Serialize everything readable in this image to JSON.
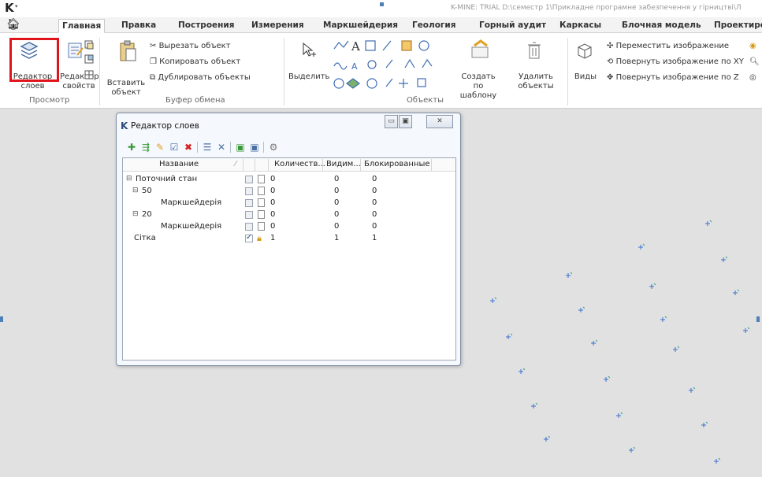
{
  "titlebar": {
    "logo": "K",
    "quick_access": "▾",
    "title": "K-MINE: TRIAL D:\\семестр 1\\Прикладне програмне забезпечення у гірництві\\Л"
  },
  "tabs": [
    {
      "label": "Главная",
      "active": true
    },
    {
      "label": "Правка"
    },
    {
      "label": "Построения"
    },
    {
      "label": "Измерения"
    },
    {
      "label": "Маркшейдерия"
    },
    {
      "label": "Геология"
    },
    {
      "label": "Горный аудит"
    },
    {
      "label": "Каркасы"
    },
    {
      "label": "Блочная модель"
    },
    {
      "label": "Проектиро"
    }
  ],
  "ribbon": {
    "layer_editor": "Редактор\nслоев",
    "props_editor": "Редактор\nсвойств",
    "view_group": "Просмотр",
    "paste": "Вставить\nобъект",
    "cut": "Вырезать объект",
    "copy": "Копировать объект",
    "duplicate": "Дублировать объекты",
    "clipboard_group": "Буфер обмена",
    "select": "Выделить",
    "create_template": "Создать по\nшаблону",
    "delete_objects": "Удалить\nобъекты",
    "objects_group": "Объекты",
    "views": "Виды",
    "move_image": "Переместить изображение",
    "rotate_xy": "Повернуть изображение по XY",
    "rotate_z": "Повернуть изображение по Z"
  },
  "dialog": {
    "title": "Редактор слоев",
    "columns": [
      "Название",
      "Количеств...",
      "Видим...",
      "Блокированные"
    ],
    "rows": [
      {
        "name": "Поточний стан",
        "level": 0,
        "expander": "⊟",
        "checked": false,
        "locked": false,
        "count": "0",
        "visible": "0",
        "blocked": "0"
      },
      {
        "name": "50",
        "level": 1,
        "expander": "⊟",
        "checked": false,
        "locked": false,
        "count": "0",
        "visible": "0",
        "blocked": "0"
      },
      {
        "name": "Маркшейдерія",
        "level": 2,
        "expander": "",
        "checked": false,
        "locked": false,
        "count": "0",
        "visible": "0",
        "blocked": "0"
      },
      {
        "name": "20",
        "level": 1,
        "expander": "⊟",
        "checked": false,
        "locked": false,
        "count": "0",
        "visible": "0",
        "blocked": "0"
      },
      {
        "name": "Маркшейдерія",
        "level": 2,
        "expander": "",
        "checked": false,
        "locked": false,
        "count": "0",
        "visible": "0",
        "blocked": "0"
      },
      {
        "name": "Сітка",
        "level": 0,
        "expander": "",
        "checked": true,
        "locked": true,
        "count": "1",
        "visible": "1",
        "blocked": "1"
      }
    ]
  },
  "colors": {
    "highlight": "#e1141b",
    "accent": "#4d7fb8",
    "point": "#3b6fd0",
    "point_tail": "#2fa58a"
  }
}
